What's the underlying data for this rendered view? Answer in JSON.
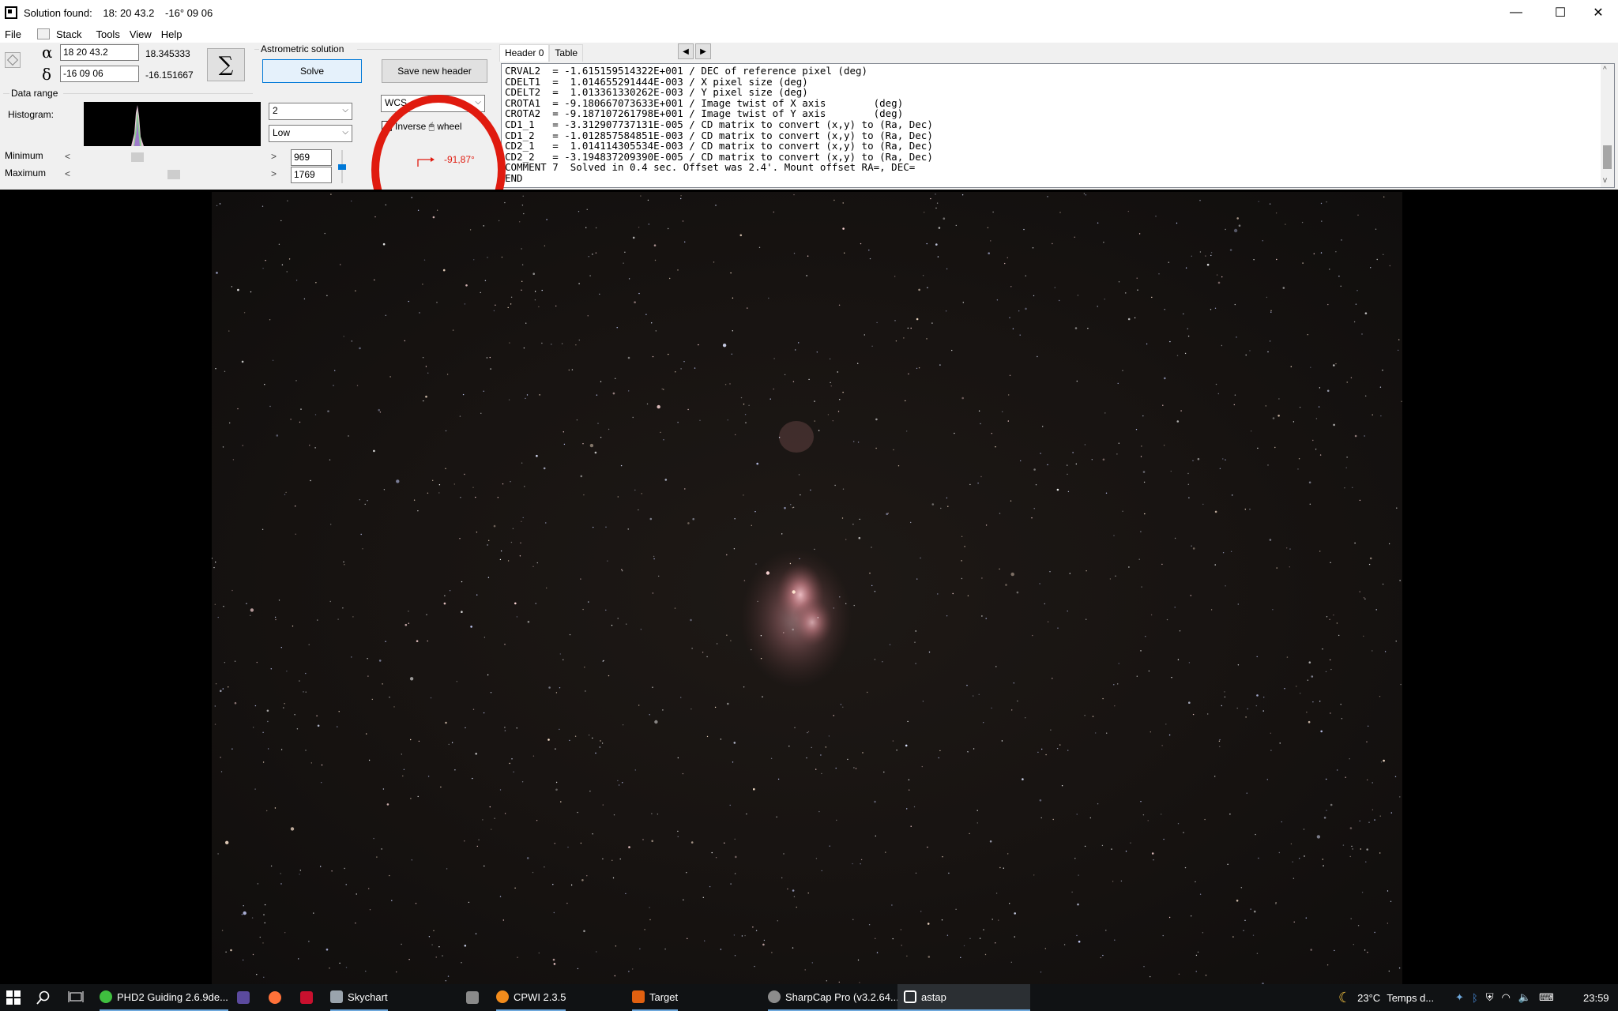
{
  "window": {
    "title_prefix": "Solution found:",
    "title_ra": "18: 20 43.2",
    "title_dec": "-16° 09 06",
    "minimize": "—",
    "maximize": "☐",
    "close": "✕"
  },
  "menu": [
    "File",
    "Stack",
    "Tools",
    "View",
    "Help"
  ],
  "coords": {
    "alpha_symbol": "α",
    "delta_symbol": "δ",
    "ra_input": "18 20 43.2",
    "ra_decimal": "18.345333",
    "dec_input": "-16 09 06",
    "dec_decimal": "-16.151667",
    "sum_symbol": "∑"
  },
  "astrometric": {
    "group_label": "Astrometric solution",
    "solve_label": "Solve",
    "save_header_label": "Save new header",
    "wcs_value": "WCS",
    "inverse_wheel_label": "Inverse 🖱 wheel",
    "inverse_wheel_checked": false,
    "rotation_value": "-91,87°"
  },
  "data_range": {
    "group_label": "Data range",
    "histogram_label": "Histogram:",
    "binning_value": "2",
    "range_value": "Low",
    "minimum_label": "Minimum",
    "maximum_label": "Maximum",
    "minimum_value": "969",
    "maximum_value": "1769",
    "minimum_slider_fraction": 0.3,
    "maximum_slider_fraction": 0.5
  },
  "header_panel": {
    "tabs": [
      "Header 0",
      "Table"
    ],
    "active_tab": 0,
    "prev_icon": "◀",
    "next_icon": "▶",
    "lines": [
      "CRVAL2  = -1.615159514322E+001 / DEC of reference pixel (deg)",
      "CDELT1  =  1.014655291444E-003 / X pixel size (deg)",
      "CDELT2  =  1.013361330262E-003 / Y pixel size (deg)",
      "CROTA1  = -9.180667073633E+001 / Image twist of X axis        (deg)",
      "CROTA2  = -9.187107261798E+001 / Image twist of Y axis        (deg)",
      "CD1_1   = -3.312907737131E-005 / CD matrix to convert (x,y) to (Ra, Dec)",
      "CD1_2   = -1.012857584851E-003 / CD matrix to convert (x,y) to (Ra, Dec)",
      "CD2_1   =  1.014114305534E-003 / CD matrix to convert (x,y) to (Ra, Dec)",
      "CD2_2   = -3.194837209390E-005 / CD matrix to convert (x,y) to (Ra, Dec)",
      "COMMENT 7  Solved in 0.4 sec. Offset was 2.4'. Mount offset RA=, DEC=",
      "END"
    ]
  },
  "taskbar": {
    "items": [
      {
        "label": "PHD2 Guiding 2.6.9de...",
        "color": "#3fbf3f"
      },
      {
        "label": "",
        "color": "#5b4a9e"
      },
      {
        "label": "",
        "color": "#ff7139"
      },
      {
        "label": "",
        "color": "#c8102e"
      },
      {
        "label": "Skychart",
        "color": "#9aa4ad"
      },
      {
        "label": "",
        "color": "#8a8a8a"
      },
      {
        "label": "CPWI 2.3.5",
        "color": "#f28c1c"
      },
      {
        "label": "Target",
        "color": "#e06010"
      },
      {
        "label": "SharpCap Pro (v3.2.64...",
        "color": "#8c8c8c"
      },
      {
        "label": "astap",
        "color": "#ffffff"
      }
    ],
    "temperature": "23°C",
    "weather": "Temps d...",
    "clock": "23:59"
  }
}
